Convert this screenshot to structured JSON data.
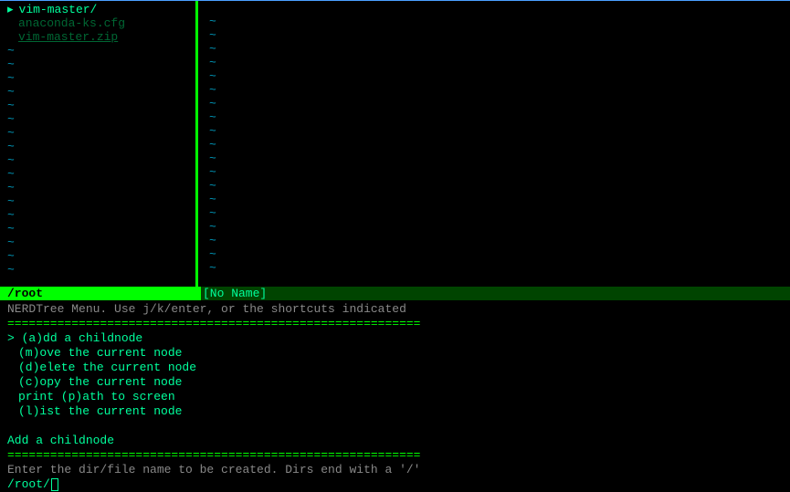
{
  "nerdtree": {
    "dir": "vim-master/",
    "files": [
      "anaconda-ks.cfg",
      "vim-master.zip"
    ],
    "tilde": "~"
  },
  "editor": {
    "tilde": "~"
  },
  "status": {
    "left": "/root",
    "right": "[No Name]"
  },
  "menu": {
    "title": "NERDTree Menu. Use j/k/enter, or the shortcuts indicated",
    "separator": "==========================================================",
    "items": [
      "(a)dd a childnode",
      "(m)ove the current node",
      "(d)elete the current node",
      "(c)opy the current node",
      "print (p)ath to screen",
      "(l)ist the current node"
    ],
    "selected_index": 0,
    "action_label": "Add a childnode",
    "prompt": "Enter the dir/file name to be created. Dirs end with a '/'",
    "input_value": "/root/"
  }
}
